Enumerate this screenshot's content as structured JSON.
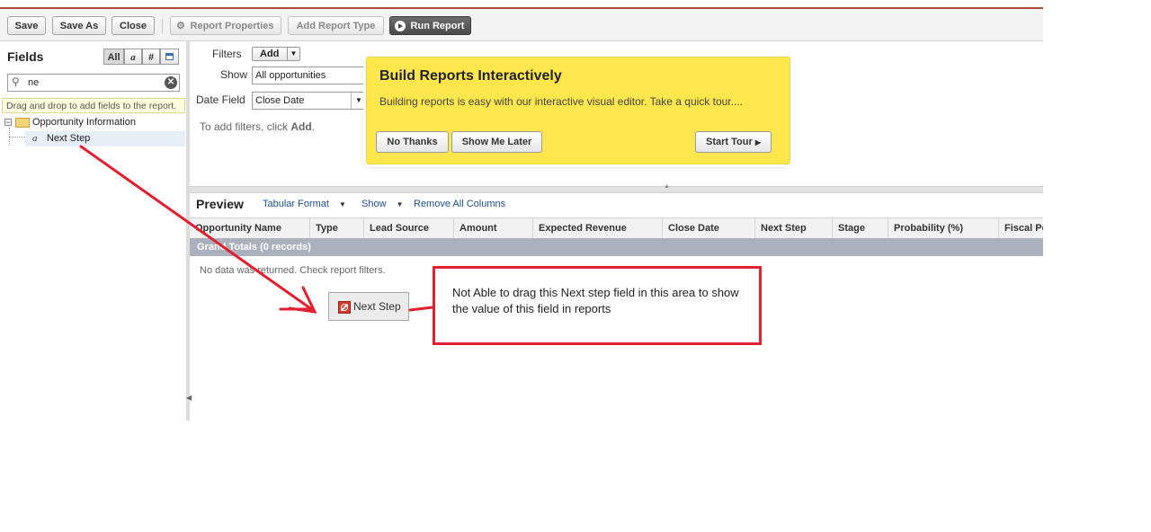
{
  "toolbar": {
    "save": "Save",
    "save_as": "Save As",
    "close": "Close",
    "report_properties": "Report Properties",
    "add_report_type": "Add Report Type",
    "run_report": "Run Report"
  },
  "fields_panel": {
    "title": "Fields",
    "filter_all": "All",
    "filter_text": "a",
    "filter_number": "#",
    "search_value": "ne",
    "tip": "Drag and drop to add fields to the report.",
    "tree_folder": "Opportunity Information",
    "tree_item": "Next Step",
    "tree_item_icon": "a"
  },
  "filters": {
    "label": "Filters",
    "add_label": "Add",
    "show_label": "Show",
    "show_value": "All opportunities",
    "date_field_label": "Date Field",
    "date_field_value": "Close Date",
    "hint_prefix": "To add filters, click ",
    "hint_bold": "Add",
    "hint_suffix": "."
  },
  "popup": {
    "title": "Build Reports Interactively",
    "body": "Building reports is easy with our interactive visual editor. Take a quick tour....",
    "no_thanks": "No Thanks",
    "show_me_later": "Show Me Later",
    "start_tour": "Start Tour"
  },
  "preview": {
    "title": "Preview",
    "format": "Tabular Format",
    "show": "Show",
    "remove_all": "Remove All Columns",
    "columns": [
      "Opportunity Name",
      "Type",
      "Lead Source",
      "Amount",
      "Expected Revenue",
      "Close Date",
      "Next Step",
      "Stage",
      "Probability (%)",
      "Fiscal Pe"
    ],
    "grand_totals": "Grand Totals (0 records)",
    "no_data": "No data was returned. Check report filters.",
    "drag_ghost": "Next Step"
  },
  "annotation": {
    "text": "Not Able to drag this Next step field in this area to show the value of this field in reports"
  },
  "colors": {
    "accent": "#a8493a",
    "popup": "#fde74c",
    "annotation": "#e3202f",
    "link": "#1f4f8a"
  }
}
